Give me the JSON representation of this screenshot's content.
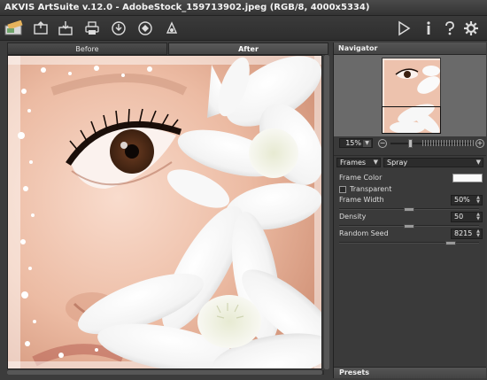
{
  "window": {
    "title": "AKVIS ArtSuite v.12.0 - AdobeStock_159713902.jpeg (RGB/8, 4000x5334)"
  },
  "toolbar": {
    "left_icons": [
      "app-logo-icon",
      "open-image-icon",
      "save-image-icon",
      "print-icon",
      "share-icon",
      "batch-icon",
      "presets-icon"
    ],
    "right_icons": [
      "run-icon",
      "info-icon",
      "help-icon",
      "settings-icon"
    ]
  },
  "tabs": [
    {
      "label": "Before",
      "active": false
    },
    {
      "label": "After",
      "active": true
    }
  ],
  "navigator": {
    "title": "Navigator",
    "zoom_value": "15%",
    "zoom_minus": "−",
    "zoom_plus": "+"
  },
  "effect": {
    "category": "Frames",
    "type": "Spray",
    "frame_color_label": "Frame Color",
    "frame_color": "#fafafa",
    "transparent_label": "Transparent",
    "frame_width_label": "Frame Width",
    "frame_width_value": "50%",
    "density_label": "Density",
    "density_value": "50",
    "random_seed_label": "Random Seed",
    "random_seed_value": "8215",
    "frame_width_level": 0.5,
    "density_level": 0.5,
    "random_seed_level": 0.82
  },
  "presets": {
    "title": "Presets"
  },
  "colors": {
    "panel_bg": "#3a3a3a",
    "toolbar_bg": "#2e2e2e",
    "accent_white": "#fafafa"
  }
}
